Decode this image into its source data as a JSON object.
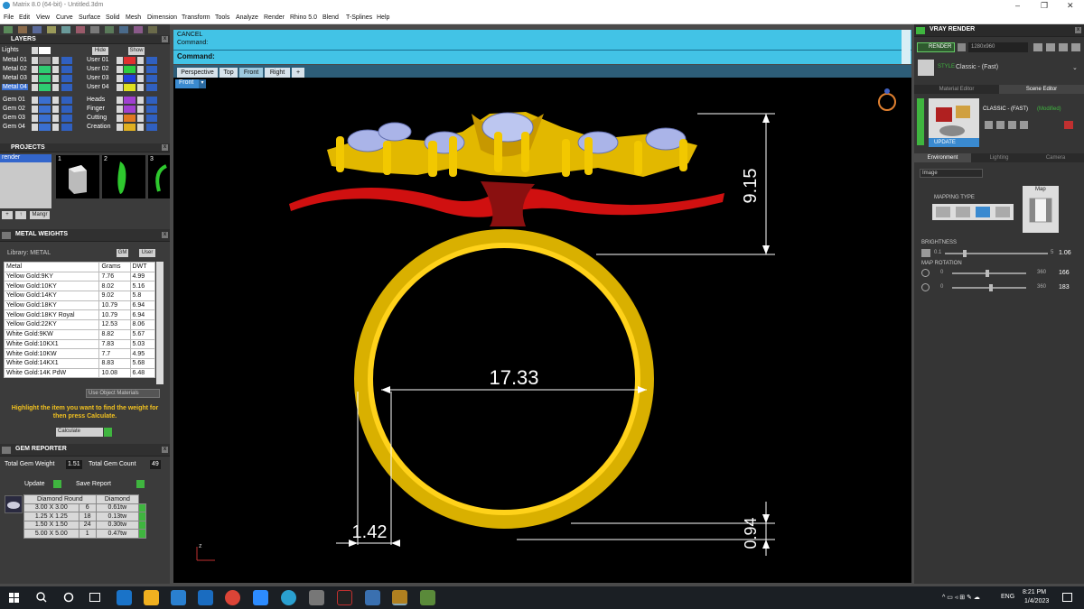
{
  "window": {
    "title": "Matrix 8.0 (64-bit) - Untitled.3dm"
  },
  "menu": [
    "File",
    "Edit",
    "View",
    "Curve",
    "Surface",
    "Solid",
    "Mesh",
    "Dimension",
    "Transform",
    "Tools",
    "Analyze",
    "Render",
    "Rhino 5.0",
    "Blend",
    "T-Splines",
    "Help"
  ],
  "layers": {
    "title": "LAYERS",
    "lights": "Lights",
    "hide": "Hide",
    "show": "Show",
    "left": [
      "Metal 01",
      "Metal 02",
      "Metal 03",
      "Metal 04",
      "Gem 01",
      "Gem 02",
      "Gem 03",
      "Gem 04"
    ],
    "right": [
      "User 01",
      "User 02",
      "User 03",
      "User 04",
      "Heads",
      "Finger",
      "Cutting",
      "Creation"
    ]
  },
  "projects": {
    "title": "PROJECTS",
    "item": "render",
    "thumb_nums": [
      "1",
      "2",
      "3"
    ],
    "manager": "Mangr"
  },
  "metal_weights": {
    "title": "METAL WEIGHTS",
    "library": "Library: METAL",
    "gm": "GM",
    "user": "User",
    "headers": [
      "Metal",
      "Grams",
      "DWT"
    ],
    "rows": [
      [
        "Yellow Gold:9KY",
        "7.76",
        "4.99"
      ],
      [
        "Yellow Gold:10KY",
        "8.02",
        "5.16"
      ],
      [
        "Yellow Gold:14KY",
        "9.02",
        "5.8"
      ],
      [
        "Yellow Gold:18KY",
        "10.79",
        "6.94"
      ],
      [
        "Yellow Gold:18KY Royal",
        "10.79",
        "6.94"
      ],
      [
        "Yellow Gold:22KY",
        "12.53",
        "8.06"
      ],
      [
        "White Gold:9KW",
        "8.82",
        "5.67"
      ],
      [
        "White Gold:10KX1",
        "7.83",
        "5.03"
      ],
      [
        "White Gold:10KW",
        "7.7",
        "4.95"
      ],
      [
        "White Gold:14KX1",
        "8.83",
        "5.68"
      ],
      [
        "White Gold:14K PdW",
        "10.08",
        "6.48"
      ]
    ],
    "use_object": "Use Object Materials",
    "hint": "Highlight the item you want to find the weight for then press Calculate.",
    "calculate": "Calculate"
  },
  "gem_reporter": {
    "title": "GEM REPORTER",
    "total_weight_label": "Total Gem Weight",
    "total_weight": "1.51",
    "total_count_label": "Total Gem Count",
    "total_count": "49",
    "update": "Update",
    "save": "Save Report",
    "headers": [
      "Diamond Round",
      "",
      "Diamond"
    ],
    "rows": [
      [
        "3.00 X 3.00",
        "6",
        "0.61tw"
      ],
      [
        "1.25 X 1.25",
        "18",
        "0.13tw"
      ],
      [
        "1.50 X 1.50",
        "24",
        "0.30tw"
      ],
      [
        "5.00 X 5.00",
        "1",
        "0.47tw"
      ]
    ]
  },
  "command": {
    "line1": "CANCEL",
    "line2": "Command:",
    "prompt": "Command:"
  },
  "viewport": {
    "tabs": [
      "Perspective",
      "Top",
      "Front",
      "Right",
      "+"
    ],
    "active": "Front",
    "label": "Front",
    "dims": {
      "height": "9.15",
      "width": "17.33",
      "thickness": "1.42",
      "bottom": "0.94"
    },
    "axis": "z"
  },
  "vray": {
    "title": "VRAY RENDER",
    "render": "RENDER",
    "resolution": "1280x960",
    "style_label": "STYLE",
    "style": "Classic - (Fast)",
    "tabs": [
      "Material Editor",
      "Scene Editor"
    ],
    "preset": "CLASSIC - (FAST)",
    "modified": "(Modified)",
    "update": "UPDATE",
    "subtabs": [
      "Environment",
      "Lighting",
      "Camera"
    ],
    "dropdown": "Image",
    "mapping": "MAPPING TYPE",
    "map": "Map",
    "brightness": "BRIGHTNESS",
    "b_min": "0.1",
    "b_max": "5",
    "b_val": "1.06",
    "rotation": "MAP ROTATION",
    "r_min": "0",
    "r_max": "360",
    "r1": "166",
    "r2": "183"
  },
  "taskbar": {
    "lang": "ENG",
    "time": "8:21 PM",
    "date": "1/4/2023"
  }
}
